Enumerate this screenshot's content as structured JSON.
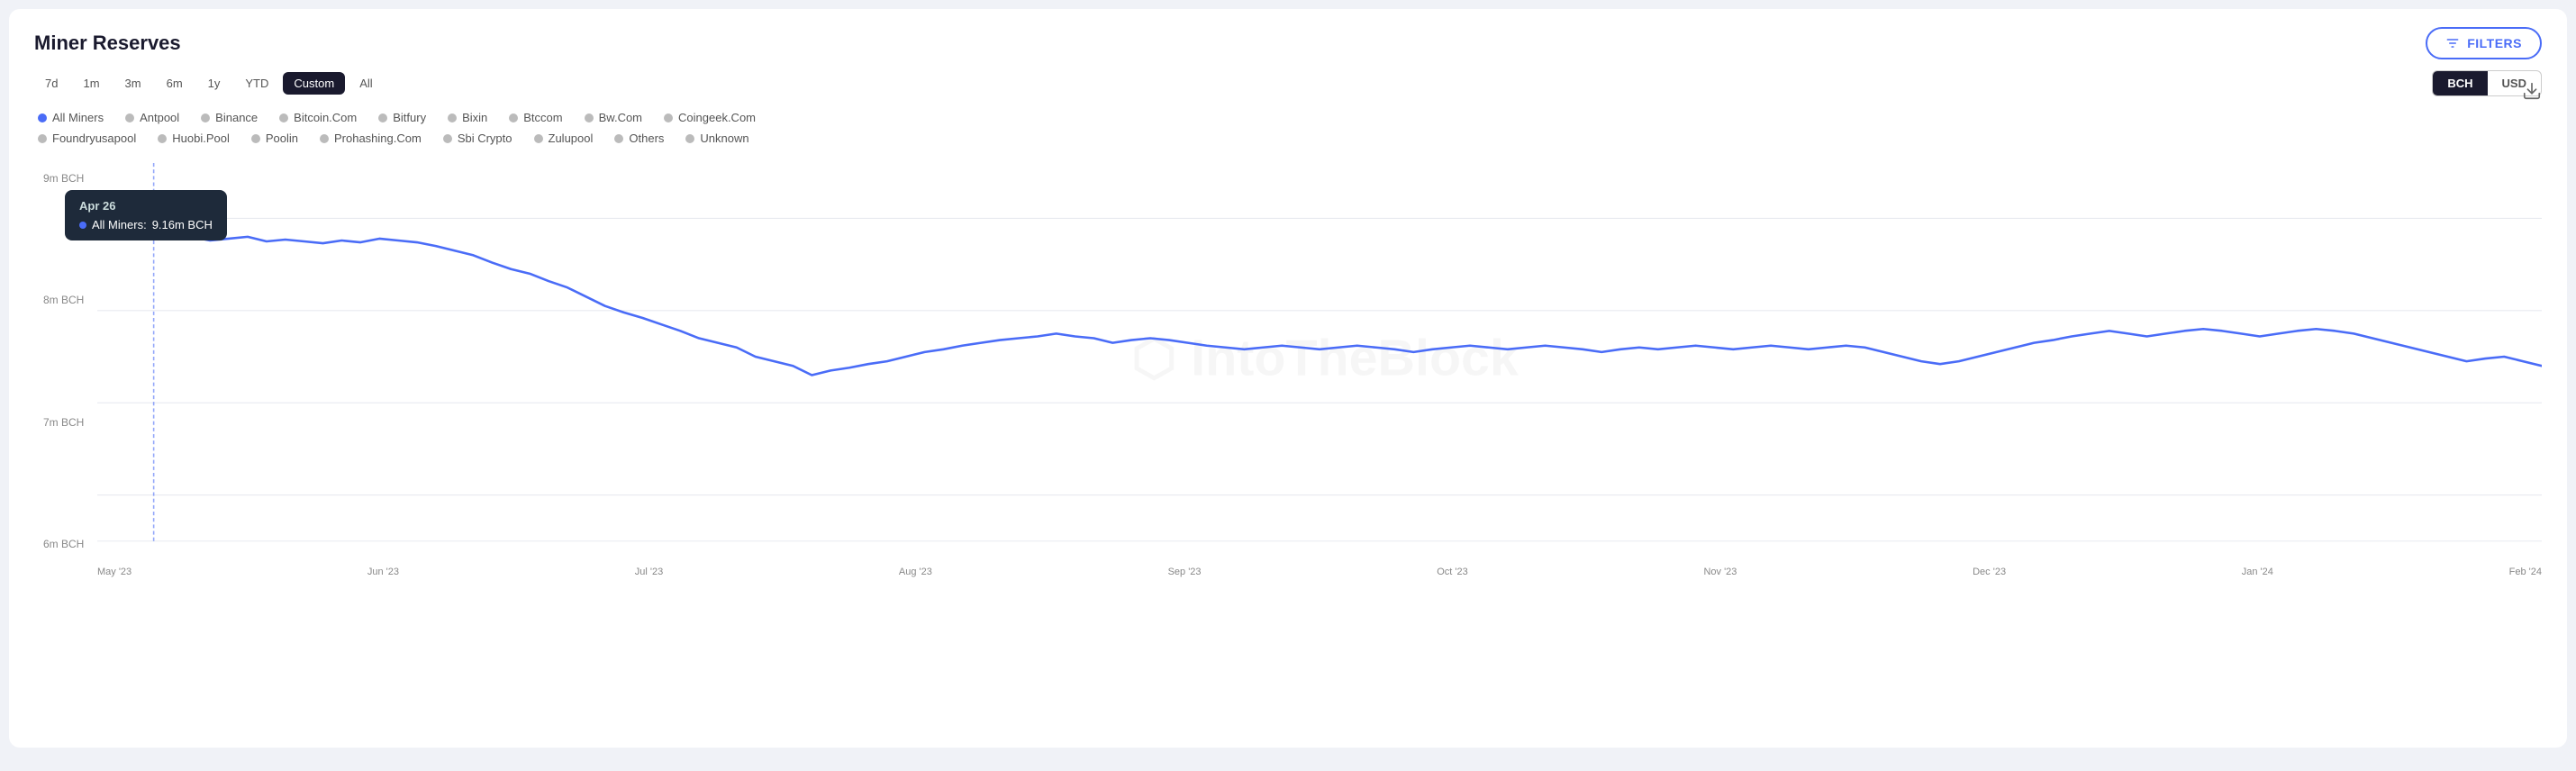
{
  "page": {
    "title": "Miner Reserves"
  },
  "header": {
    "filters_label": "FILTERS"
  },
  "toolbar": {
    "download_title": "Download"
  },
  "time_filters": {
    "options": [
      {
        "label": "7d",
        "active": false
      },
      {
        "label": "1m",
        "active": false
      },
      {
        "label": "3m",
        "active": false
      },
      {
        "label": "6m",
        "active": false
      },
      {
        "label": "1y",
        "active": false
      },
      {
        "label": "YTD",
        "active": false
      },
      {
        "label": "Custom",
        "active": true
      },
      {
        "label": "All",
        "active": false
      }
    ]
  },
  "currency_toggle": {
    "options": [
      {
        "label": "BCH",
        "active": true
      },
      {
        "label": "USD",
        "active": false
      }
    ]
  },
  "legend": {
    "items": [
      {
        "label": "All Miners",
        "color": "#4a6cf7",
        "active": true
      },
      {
        "label": "Antpool",
        "color": "#bbb",
        "active": false
      },
      {
        "label": "Binance",
        "color": "#bbb",
        "active": false
      },
      {
        "label": "Bitcoin.Com",
        "color": "#bbb",
        "active": false
      },
      {
        "label": "Bitfury",
        "color": "#bbb",
        "active": false
      },
      {
        "label": "Bixin",
        "color": "#bbb",
        "active": false
      },
      {
        "label": "Btccom",
        "color": "#bbb",
        "active": false
      },
      {
        "label": "Bw.Com",
        "color": "#bbb",
        "active": false
      },
      {
        "label": "Coingeek.Com",
        "color": "#bbb",
        "active": false
      },
      {
        "label": "Foundryusapool",
        "color": "#bbb",
        "active": false
      },
      {
        "label": "Huobi.Pool",
        "color": "#bbb",
        "active": false
      },
      {
        "label": "Poolin",
        "color": "#bbb",
        "active": false
      },
      {
        "label": "Prohashing.Com",
        "color": "#bbb",
        "active": false
      },
      {
        "label": "Sbi Crypto",
        "color": "#bbb",
        "active": false
      },
      {
        "label": "Zulupool",
        "color": "#bbb",
        "active": false
      },
      {
        "label": "Others",
        "color": "#bbb",
        "active": false
      },
      {
        "label": "Unknown",
        "color": "#bbb",
        "active": false
      }
    ]
  },
  "tooltip": {
    "date": "Apr 26",
    "label": "All Miners:",
    "value": "9.16m BCH"
  },
  "y_axis": {
    "labels": [
      "9m BCH",
      "8m BCH",
      "7m BCH",
      "6m BCH"
    ]
  },
  "x_axis": {
    "labels": [
      "May '23",
      "Jun '23",
      "Jul '23",
      "Aug '23",
      "Sep '23",
      "Oct '23",
      "Nov '23",
      "Dec '23",
      "Jan '24",
      "Feb '24"
    ]
  },
  "watermark": {
    "text": "IntoTheBlock"
  }
}
